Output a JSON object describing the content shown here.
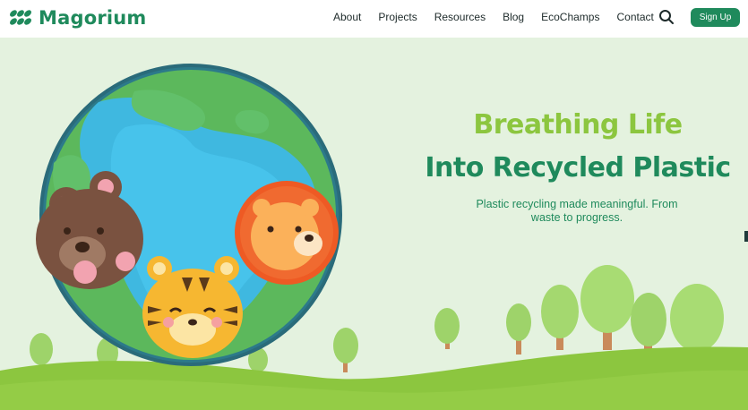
{
  "brand": {
    "name": "Magorium",
    "logo_icon": "leaf-cluster-icon",
    "color": "#1f8a5c"
  },
  "nav": {
    "items": [
      "About",
      "Projects",
      "Resources",
      "Blog",
      "EcoChamps",
      "Contact"
    ]
  },
  "search": {
    "icon": "search-icon"
  },
  "signup": {
    "label": "Sign Up"
  },
  "hero": {
    "headline_line1": "Breathing Life",
    "headline_line2": "Into Recycled Plastic",
    "subtitle": "Plastic recycling made meaningful. From waste to progress.",
    "illustration": [
      "earth-globe",
      "bear",
      "tiger",
      "lion",
      "trees",
      "grass-hill"
    ]
  },
  "colors": {
    "accent": "#1f8a5c",
    "light_green": "#8cc63f",
    "background": "#e4f2df",
    "ocean": "#3fb8e0",
    "land": "#5cb85c"
  }
}
